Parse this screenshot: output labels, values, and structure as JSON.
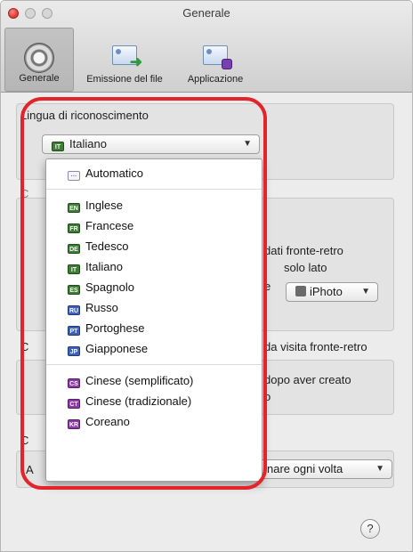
{
  "window": {
    "title": "Generale"
  },
  "toolbar": {
    "items": [
      {
        "label": "Generale",
        "icon": "gear-icon"
      },
      {
        "label": "Emissione del file",
        "icon": "card-export-icon"
      },
      {
        "label": "Applicazione",
        "icon": "card-app-icon"
      }
    ]
  },
  "main": {
    "recognition_language_label": "Lingua di riconoscimento",
    "selected_language": "Italiano",
    "section2_label_visible": "C",
    "option_text_line1": "dati fronte-retro",
    "option_text_line2": "solo lato",
    "option_text_line3": "e",
    "iphoto_popup_value": "iPhoto",
    "section3_label_visible": "C",
    "section3_label_right": "da visita fronte-retro",
    "option3_line1": "dopo aver creato",
    "option3_line2": "o",
    "section4_label_visible": "C",
    "row4_prefix": "A",
    "mode_popup_value": "nare ogni volta",
    "help_label": "?"
  },
  "language_menu": {
    "items": [
      {
        "code": "···",
        "label": "Automatico",
        "flag": "gray"
      },
      {
        "code": "EN",
        "label": "Inglese",
        "flag": "green"
      },
      {
        "code": "FR",
        "label": "Francese",
        "flag": "green"
      },
      {
        "code": "DE",
        "label": "Tedesco",
        "flag": "green"
      },
      {
        "code": "IT",
        "label": "Italiano",
        "flag": "green"
      },
      {
        "code": "ES",
        "label": "Spagnolo",
        "flag": "green"
      },
      {
        "code": "RU",
        "label": "Russo",
        "flag": "blue"
      },
      {
        "code": "PT",
        "label": "Portoghese",
        "flag": "blue"
      },
      {
        "code": "JP",
        "label": "Giapponese",
        "flag": "blue"
      },
      {
        "code": "CS",
        "label": "Cinese (semplificato)",
        "flag": "purple"
      },
      {
        "code": "CT",
        "label": "Cinese (tradizionale)",
        "flag": "purple"
      },
      {
        "code": "KR",
        "label": "Coreano",
        "flag": "purple"
      }
    ]
  },
  "colors": {
    "highlight": "#e3242b",
    "flag_green": "#3d7d34",
    "flag_blue": "#3f62b6",
    "flag_purple": "#8c3aa6"
  }
}
